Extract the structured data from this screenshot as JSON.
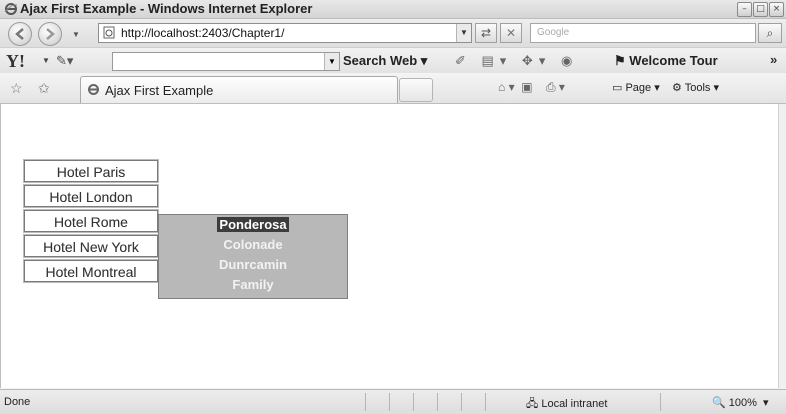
{
  "window": {
    "title": "Ajax First Example - Windows Internet Explorer",
    "controls": [
      "minimize-icon",
      "maximize-icon",
      "close-icon"
    ]
  },
  "address_bar": {
    "url": "http://localhost:2403/Chapter1/",
    "search_placeholder": "Google"
  },
  "yahoo_toolbar": {
    "logo": "Y!",
    "search_web_label": "Search Web",
    "welcome_label": "Welcome Tour",
    "more": "»"
  },
  "tabs": [
    {
      "label": "Ajax First Example"
    }
  ],
  "command_bar": {
    "page_label": "Page",
    "tools_label": "Tools"
  },
  "hotels": [
    {
      "label": "Hotel Paris"
    },
    {
      "label": "Hotel London"
    },
    {
      "label": "Hotel Rome"
    },
    {
      "label": "Hotel New York"
    },
    {
      "label": "Hotel Montreal"
    }
  ],
  "popup": {
    "items": [
      {
        "label": "Ponderosa",
        "selected": true
      },
      {
        "label": "Colonade",
        "selected": false
      },
      {
        "label": "Dunrcamin",
        "selected": false
      },
      {
        "label": "Family",
        "selected": false
      }
    ]
  },
  "status_bar": {
    "status": "Done",
    "zone": "Local intranet",
    "zoom": "100%"
  }
}
